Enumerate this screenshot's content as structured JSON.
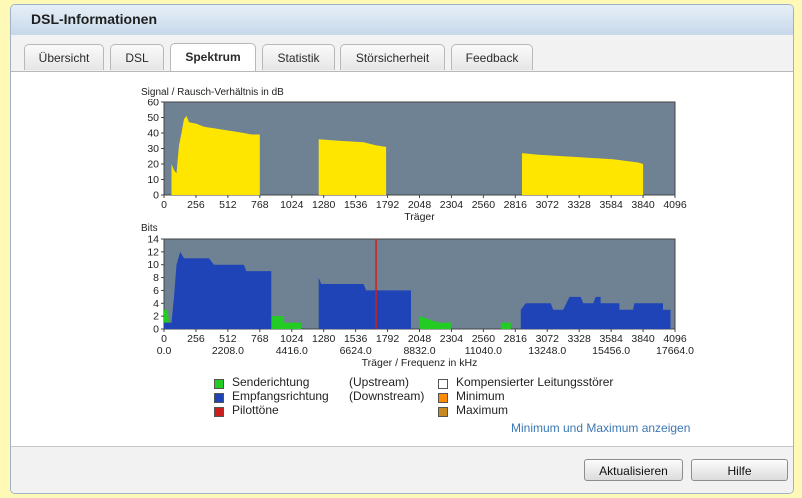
{
  "window": {
    "title": "DSL-Informationen"
  },
  "tabs": [
    {
      "label": "Übersicht"
    },
    {
      "label": "DSL"
    },
    {
      "label": "Spektrum",
      "active": true
    },
    {
      "label": "Statistik"
    },
    {
      "label": "Störsicherheit"
    },
    {
      "label": "Feedback"
    }
  ],
  "chart1_title": "Signal / Rausch-Verhältnis in dB",
  "chart2_title": "Bits",
  "chart_data": [
    {
      "type": "area",
      "title": "Signal / Rausch-Verhältnis in dB",
      "xlabel": "Träger",
      "ylabel": "",
      "xlim": [
        0,
        4096
      ],
      "ylim": [
        0,
        60
      ],
      "x_ticks": [
        "0",
        "256",
        "512",
        "768",
        "1024",
        "1280",
        "1536",
        "1792",
        "2048",
        "2304",
        "2560",
        "2816",
        "3072",
        "3328",
        "3584",
        "3840",
        "4096"
      ],
      "y_ticks": [
        "0",
        "10",
        "20",
        "30",
        "40",
        "50",
        "60"
      ],
      "plot_background": "#6e8294",
      "series": [
        {
          "color": "#ffe600",
          "points": [
            [
              60,
              0
            ],
            [
              60,
              20
            ],
            [
              80,
              16
            ],
            [
              100,
              14
            ],
            [
              120,
              32
            ],
            [
              140,
              40
            ],
            [
              160,
              49
            ],
            [
              180,
              51
            ],
            [
              200,
              47
            ],
            [
              260,
              46
            ],
            [
              320,
              44
            ],
            [
              400,
              43
            ],
            [
              480,
              42
            ],
            [
              560,
              41
            ],
            [
              640,
              40
            ],
            [
              700,
              39
            ],
            [
              768,
              39
            ],
            [
              768,
              0
            ]
          ]
        },
        {
          "color": "#ffe600",
          "points": [
            [
              1240,
              0
            ],
            [
              1240,
              36
            ],
            [
              1400,
              35
            ],
            [
              1600,
              34
            ],
            [
              1700,
              32
            ],
            [
              1780,
              31
            ],
            [
              1780,
              0
            ]
          ]
        },
        {
          "color": "#ffe600",
          "points": [
            [
              2870,
              0
            ],
            [
              2870,
              27
            ],
            [
              3000,
              26
            ],
            [
              3200,
              25
            ],
            [
              3400,
              24
            ],
            [
              3600,
              23
            ],
            [
              3800,
              21
            ],
            [
              3840,
              20
            ],
            [
              3840,
              0
            ]
          ]
        }
      ]
    },
    {
      "type": "area",
      "title": "Bits",
      "xlabel": "Träger / Frequenz in kHz",
      "ylabel": "",
      "xlim": [
        0,
        4096
      ],
      "ylim": [
        0,
        14
      ],
      "x_ticks": [
        "0",
        "256",
        "512",
        "768",
        "1024",
        "1280",
        "1536",
        "1792",
        "2048",
        "2304",
        "2560",
        "2816",
        "3072",
        "3328",
        "3584",
        "3840",
        "4096"
      ],
      "x_ticks_khz": [
        "0.0",
        "2208.0",
        "4416.0",
        "6624.0",
        "8832.0",
        "11040.0",
        "13248.0",
        "15456.0",
        "17664.0"
      ],
      "y_ticks": [
        "0",
        "2",
        "4",
        "6",
        "8",
        "10",
        "12",
        "14"
      ],
      "plot_background": "#6e8294",
      "series": [
        {
          "name": "Senderichtung (Upstream)",
          "color": "#22cc22",
          "points": [
            [
              0,
              0
            ],
            [
              0,
              3
            ],
            [
              30,
              3
            ],
            [
              40,
              1
            ],
            [
              60,
              0
            ],
            [
              840,
              0
            ],
            [
              840,
              2
            ],
            [
              960,
              2
            ],
            [
              960,
              1
            ],
            [
              1100,
              1
            ],
            [
              1100,
              0
            ],
            [
              2050,
              0
            ],
            [
              2050,
              2
            ],
            [
              2200,
              1
            ],
            [
              2300,
              1
            ],
            [
              2300,
              0
            ],
            [
              2700,
              0
            ],
            [
              2700,
              1
            ],
            [
              2780,
              1
            ],
            [
              2780,
              0
            ]
          ]
        },
        {
          "name": "Empfangsrichtung (Downstream)",
          "color": "#1f44b8",
          "points": [
            [
              0,
              0
            ],
            [
              0,
              1
            ],
            [
              60,
              1
            ],
            [
              80,
              5
            ],
            [
              100,
              10
            ],
            [
              130,
              12
            ],
            [
              160,
              11
            ],
            [
              200,
              11
            ],
            [
              360,
              11
            ],
            [
              400,
              10
            ],
            [
              640,
              10
            ],
            [
              660,
              9
            ],
            [
              780,
              9
            ],
            [
              860,
              9
            ],
            [
              860,
              0
            ],
            [
              1240,
              0
            ],
            [
              1240,
              8
            ],
            [
              1260,
              7
            ],
            [
              1400,
              7
            ],
            [
              1600,
              7
            ],
            [
              1620,
              6
            ],
            [
              1980,
              6
            ],
            [
              1980,
              0
            ],
            [
              2860,
              0
            ],
            [
              2860,
              3
            ],
            [
              2900,
              4
            ],
            [
              3100,
              4
            ],
            [
              3120,
              3
            ],
            [
              3200,
              3
            ],
            [
              3250,
              5
            ],
            [
              3340,
              5
            ],
            [
              3360,
              4
            ],
            [
              3440,
              4
            ],
            [
              3460,
              5
            ],
            [
              3500,
              5
            ],
            [
              3500,
              4
            ],
            [
              3650,
              4
            ],
            [
              3650,
              3
            ],
            [
              3760,
              3
            ],
            [
              3770,
              4
            ],
            [
              4000,
              4
            ],
            [
              4000,
              3
            ],
            [
              4060,
              3
            ],
            [
              4060,
              0
            ]
          ]
        }
      ],
      "pilot_tones": [
        {
          "name": "Pilottöne",
          "color": "#cc2020",
          "x": 1700
        }
      ]
    }
  ],
  "legend": {
    "send": "Senderichtung",
    "send_dir": "(Upstream)",
    "recv": "Empfangsrichtung",
    "recv_dir": "(Downstream)",
    "pilot": "Pilottöne",
    "comp": "Kompensierter Leitungsstörer",
    "min": "Minimum",
    "max": "Maximum",
    "colors": {
      "send": "#22cc22",
      "recv": "#1f44b8",
      "pilot": "#cc2020",
      "comp": "#ffffff",
      "min": "#ff8c00",
      "max": "#c88a20"
    }
  },
  "links": {
    "show_minmax": "Minimum und Maximum anzeigen"
  },
  "buttons": {
    "refresh": "Aktualisieren",
    "help": "Hilfe"
  }
}
